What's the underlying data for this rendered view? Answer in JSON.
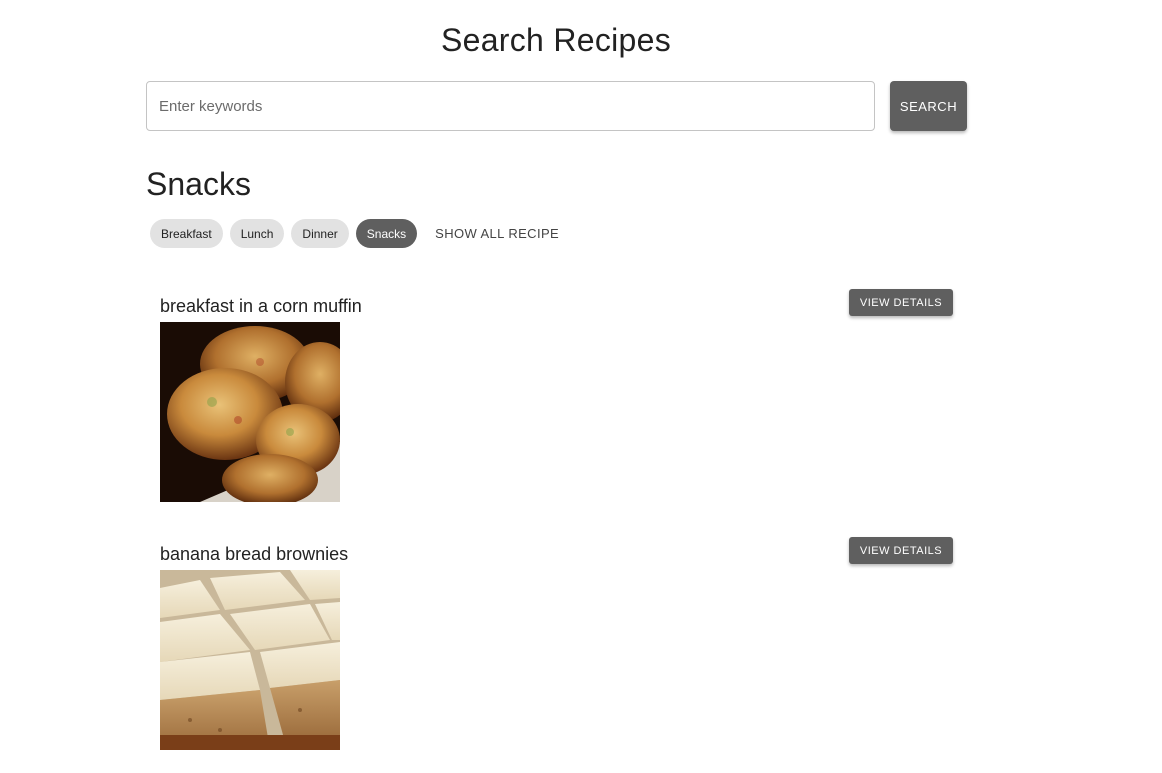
{
  "header": {
    "title": "Search Recipes"
  },
  "search": {
    "placeholder": "Enter keywords",
    "value": "",
    "button_label": "SEARCH"
  },
  "category": {
    "heading": "Snacks",
    "chips": [
      {
        "label": "Breakfast",
        "selected": false
      },
      {
        "label": "Lunch",
        "selected": false
      },
      {
        "label": "Dinner",
        "selected": false
      },
      {
        "label": "Snacks",
        "selected": true
      }
    ],
    "show_all_label": "SHOW ALL RECIPE"
  },
  "recipes": [
    {
      "title": "breakfast in a corn muffin",
      "button_label": "VIEW DETAILS",
      "image": "corn-muffin-photo"
    },
    {
      "title": "banana bread brownies",
      "button_label": "VIEW DETAILS",
      "image": "banana-bread-brownies-photo"
    }
  ],
  "colors": {
    "button_bg": "#5f5f5f",
    "chip_bg": "#e2e2e2",
    "chip_selected_bg": "#5f5f5f"
  }
}
